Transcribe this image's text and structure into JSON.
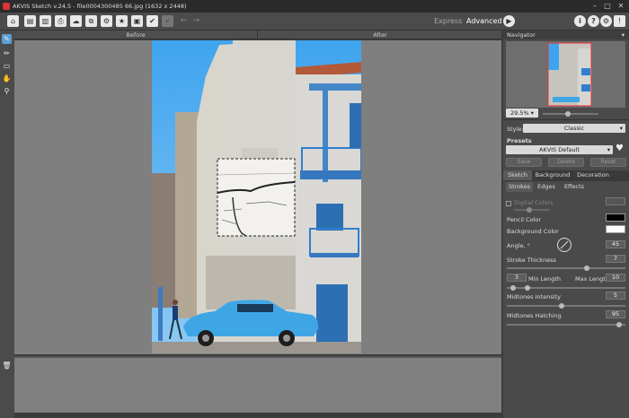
{
  "window": {
    "title": "AKVIS Sketch v.24.5 - file0004300485 66.jpg (1632 x 2448)",
    "controls": [
      "–",
      "□",
      "✕"
    ]
  },
  "toolbar": {
    "modes": {
      "express": "Express",
      "advanced": "Advanced"
    },
    "buttons": [
      {
        "name": "home-icon",
        "glyph": "⌂"
      },
      {
        "name": "open-file-icon",
        "glyph": "▤"
      },
      {
        "name": "save-file-icon",
        "glyph": "▥"
      },
      {
        "name": "print-icon",
        "glyph": "⎙"
      },
      {
        "name": "cloud-share-icon",
        "glyph": "☁"
      },
      {
        "name": "batch-icon",
        "glyph": "⧉"
      },
      {
        "name": "settings-image-icon",
        "glyph": "⚙"
      },
      {
        "name": "presets-icon",
        "glyph": "★"
      },
      {
        "name": "info-image-icon",
        "glyph": "▣"
      },
      {
        "name": "apply-icon",
        "glyph": "✔"
      },
      {
        "name": "disabled-apply-icon",
        "glyph": "✔"
      }
    ],
    "right_icons": [
      "info-icon",
      "help-icon",
      "settings-gear-icon",
      "notifications-icon"
    ]
  },
  "view": {
    "before_label": "Before",
    "after_label": "After"
  },
  "navigator": {
    "title": "Navigator",
    "zoom": "29.5%",
    "zoom_slider": 0.45
  },
  "style": {
    "label": "Style:",
    "value": "Classic"
  },
  "presets": {
    "label": "Presets",
    "value": "AKVIS Default",
    "save": "Save",
    "delete": "Delete",
    "reset": "Reset"
  },
  "tabs": [
    "Sketch",
    "Background",
    "Decoration"
  ],
  "subtabs": [
    "Strokes",
    "Edges",
    "Effects"
  ],
  "settings": {
    "digital_colors": "Digital Colors",
    "pencil_color_label": "Pencil Color",
    "pencil_color": "#000000",
    "background_color_label": "Background Color",
    "background_color": "#ffffff",
    "angle_label": "Angle, °",
    "angle_value": "45",
    "stroke_thickness_label": "Stroke Thickness",
    "stroke_thickness_value": "7",
    "min_length_value": "3",
    "min_length_label": "Min Length",
    "max_length_label": "Max Length",
    "max_length_value": "10",
    "midtones_intensity_label": "Midtones Intensity",
    "midtones_intensity_value": "5",
    "midtones_hatching_label": "Midtones Hatching",
    "midtones_hatching_value": "95"
  }
}
